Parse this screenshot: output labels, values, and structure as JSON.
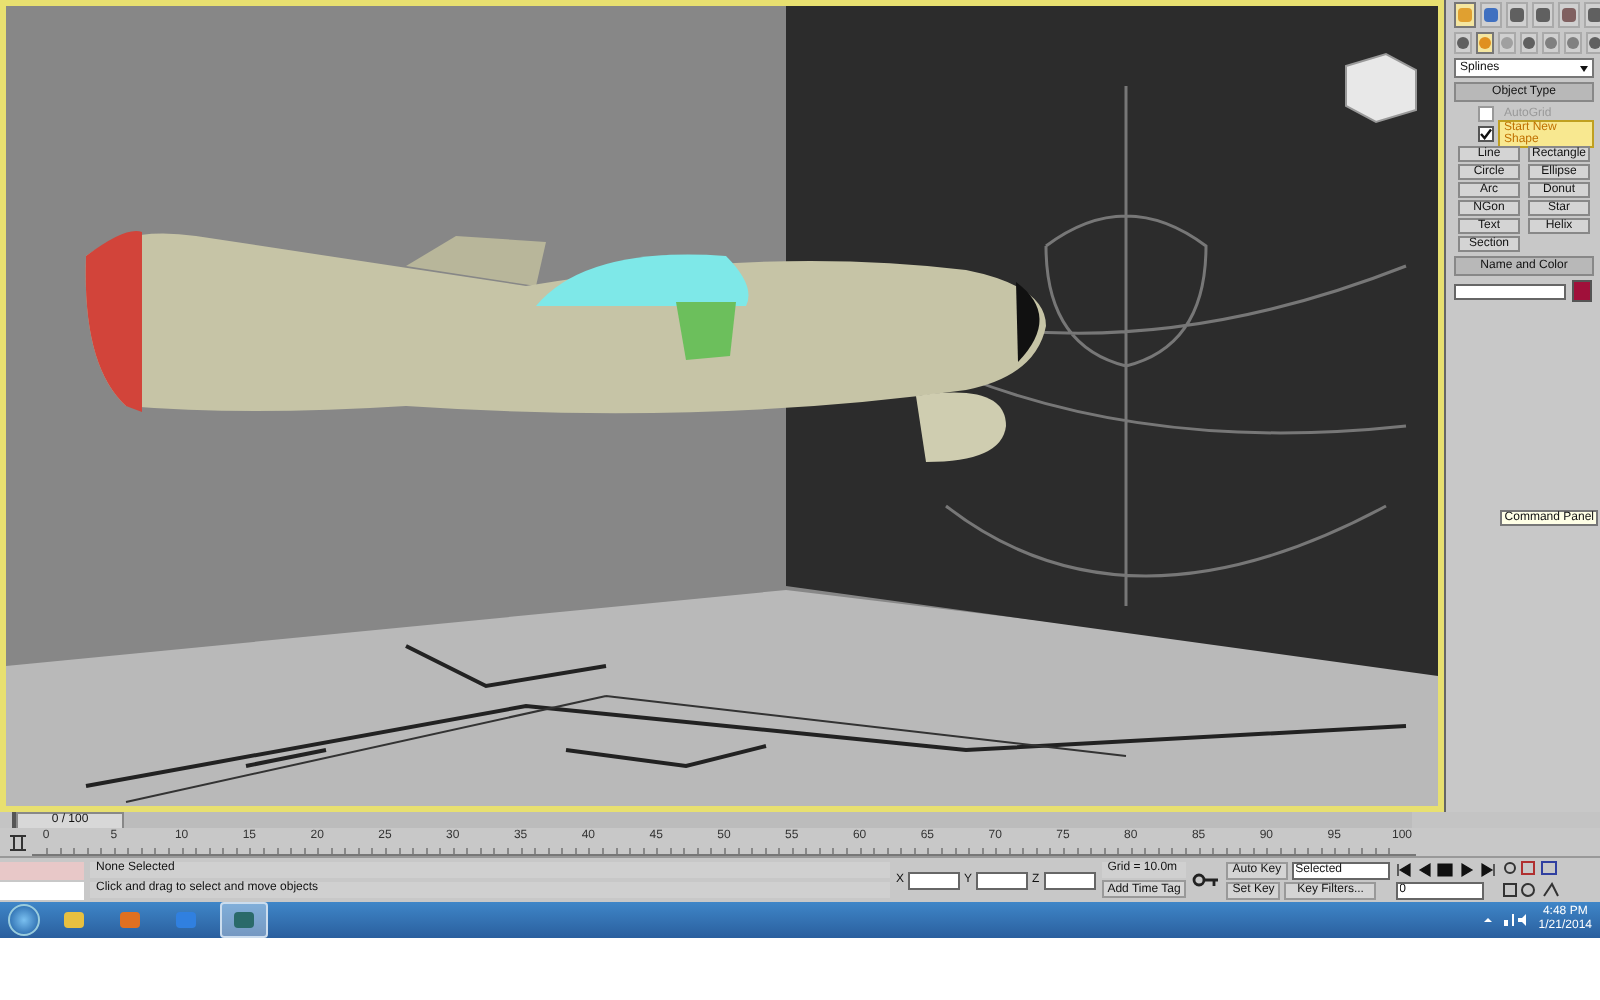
{
  "command_panel": {
    "tabs": [
      {
        "kind": "create",
        "selected": true
      },
      {
        "kind": "modify",
        "selected": false
      },
      {
        "kind": "hierarchy",
        "selected": false
      },
      {
        "kind": "motion",
        "selected": false
      },
      {
        "kind": "display",
        "selected": false
      },
      {
        "kind": "utilities",
        "selected": false
      }
    ],
    "categories": [
      {
        "kind": "geometry",
        "selected": false
      },
      {
        "kind": "shapes",
        "selected": true
      },
      {
        "kind": "lights",
        "selected": false
      },
      {
        "kind": "cameras",
        "selected": false
      },
      {
        "kind": "helpers",
        "selected": false
      },
      {
        "kind": "spacewarps",
        "selected": false
      },
      {
        "kind": "systems",
        "selected": false
      }
    ],
    "dropdown": "Splines",
    "object_type": {
      "title": "Object Type",
      "options": [
        {
          "label": "AutoGrid",
          "checked": false,
          "disabled": true
        },
        {
          "label": "Start New Shape",
          "checked": true,
          "disabled": false
        }
      ],
      "buttons": [
        "Line",
        "Rectangle",
        "Circle",
        "Ellipse",
        "Arc",
        "Donut",
        "NGon",
        "Star",
        "Text",
        "Helix",
        "Section"
      ]
    },
    "name_and_color": {
      "title": "Name and Color",
      "color": "#a0103a"
    },
    "tooltip": "Command Panel"
  },
  "timeline": {
    "slider": "0 / 100",
    "level": 0,
    "ticks": [
      "0",
      "5",
      "10",
      "15",
      "20",
      "25",
      "30",
      "35",
      "40",
      "45",
      "50",
      "55",
      "60",
      "65",
      "70",
      "75",
      "80",
      "85",
      "90",
      "95",
      "100"
    ]
  },
  "status": {
    "selection": "None Selected",
    "prompt": "Click and drag to select and move objects",
    "coords": [
      "X",
      "Y",
      "Z"
    ],
    "grid": "Grid = 10.0m",
    "time_tag": "Add Time Tag",
    "auto_key": "Auto Key",
    "key_mode": "Selected",
    "set_key": "Set Key",
    "key_filters": "Key Filters...",
    "frame": "0"
  },
  "taskbar": {
    "apps": [
      {
        "kind": "explorer",
        "selected": false
      },
      {
        "kind": "media",
        "selected": false
      },
      {
        "kind": "browser",
        "selected": false
      },
      {
        "kind": "max",
        "selected": true
      }
    ],
    "time": "4:48 PM",
    "date": "1/21/2014"
  }
}
